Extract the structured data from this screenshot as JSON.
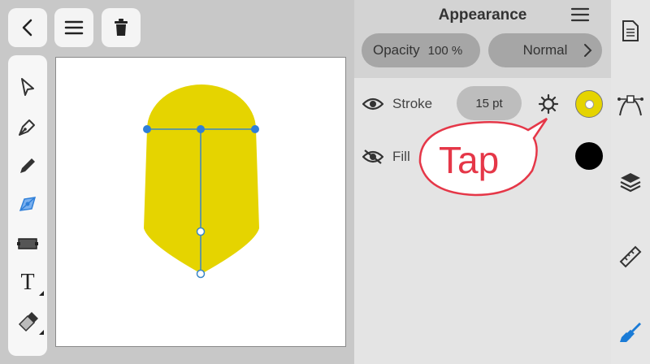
{
  "top_buttons": [
    {
      "name": "back",
      "icon": "chevron-left-icon"
    },
    {
      "name": "menu",
      "icon": "hamburger-icon"
    },
    {
      "name": "delete",
      "icon": "trash-icon"
    }
  ],
  "toolbar": {
    "tools": [
      {
        "name": "select",
        "icon": "arrow-cursor-icon"
      },
      {
        "name": "pen",
        "icon": "pen-nib-icon"
      },
      {
        "name": "pencil",
        "icon": "pencil-icon"
      },
      {
        "name": "shape",
        "icon": "node-shape-icon"
      },
      {
        "name": "rectangle",
        "icon": "rectangle-icon"
      },
      {
        "name": "text",
        "icon": "text-icon"
      },
      {
        "name": "eraser",
        "icon": "eraser-icon"
      }
    ],
    "text_glyph": "T"
  },
  "panel": {
    "title": "Appearance",
    "opacity_label": "Opacity",
    "opacity_value": "100 %",
    "blend_mode": "Normal",
    "stroke_label": "Stroke",
    "stroke_width": "15 pt",
    "fill_label": "Fill",
    "stroke_color": "#e5d400",
    "fill_color": "#000000"
  },
  "shape_color": "#e5d400",
  "annotation": {
    "text": "Tap",
    "color": "#e53748"
  },
  "right_bar": [
    {
      "name": "document",
      "icon": "document-icon"
    },
    {
      "name": "vector",
      "icon": "bezier-icon"
    },
    {
      "name": "layers",
      "icon": "layers-icon"
    },
    {
      "name": "ruler",
      "icon": "ruler-icon"
    },
    {
      "name": "brush",
      "icon": "paintbrush-icon"
    }
  ]
}
